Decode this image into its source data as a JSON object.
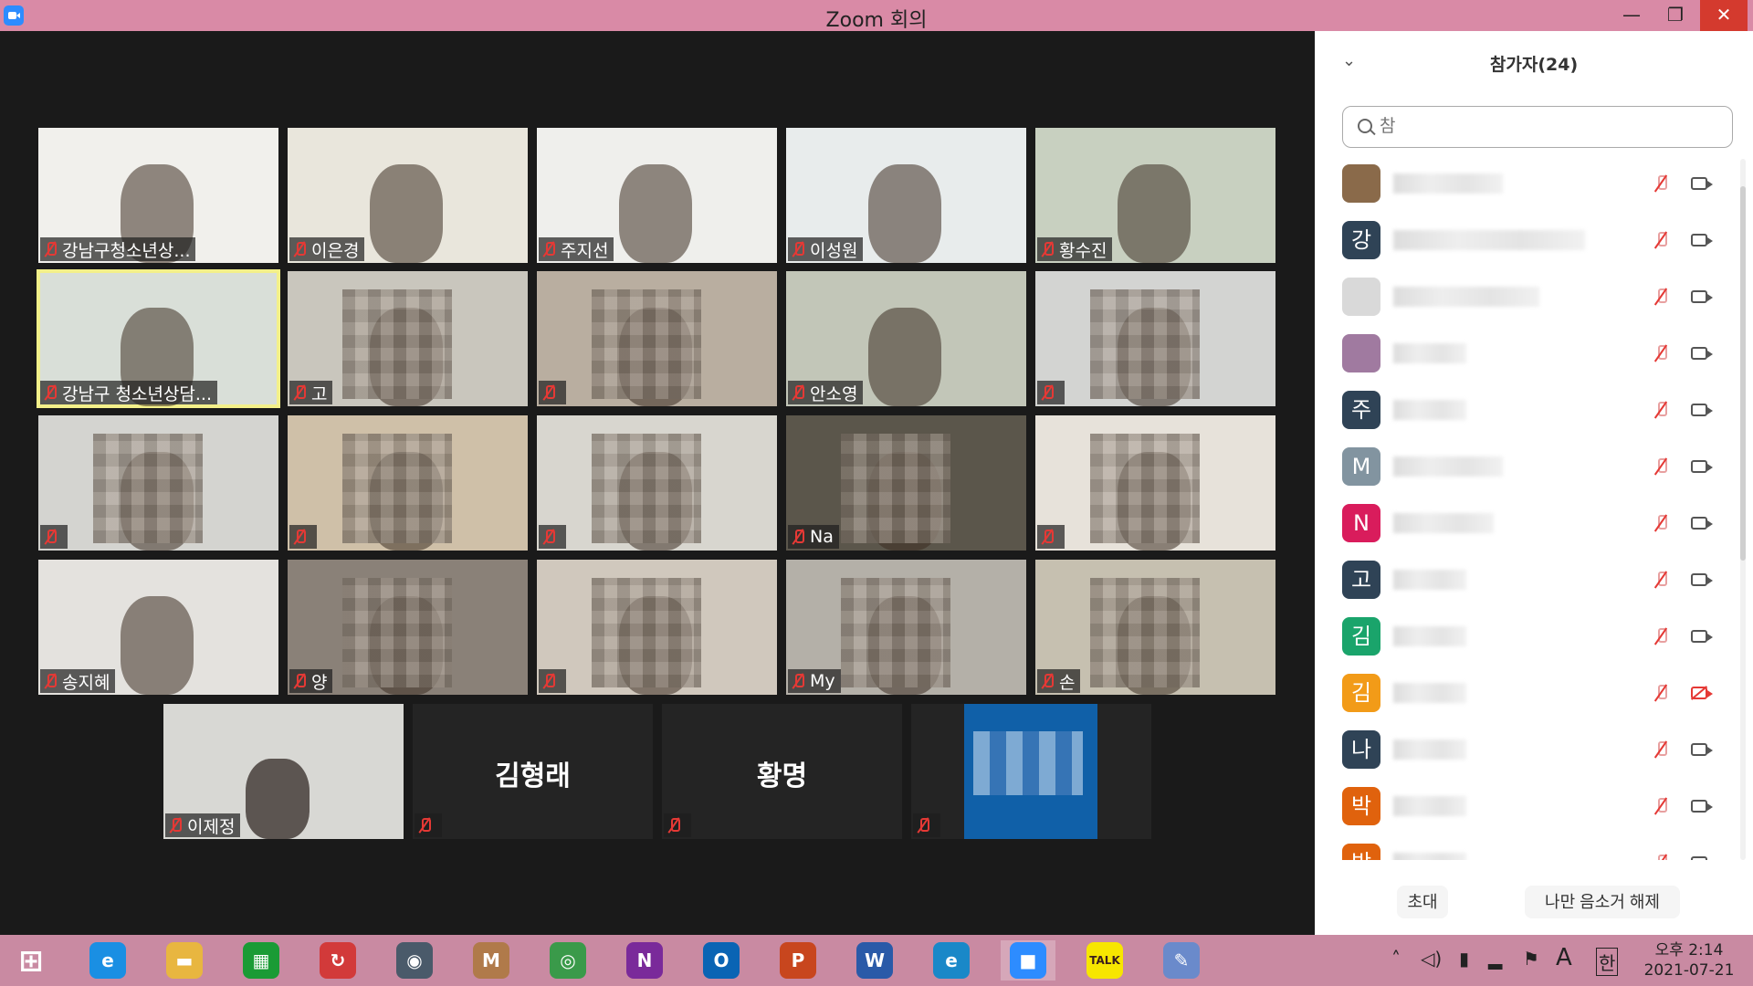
{
  "window": {
    "title": "Zoom 회의",
    "minimize": "—",
    "restore": "❐",
    "close": "✕"
  },
  "gallery": {
    "tiles": [
      {
        "name": "강남구청소년상...",
        "bg": "#f1f0ec",
        "active": false
      },
      {
        "name": "이은경",
        "bg": "#e9e6dc",
        "active": false
      },
      {
        "name": "주지선",
        "bg": "#efefec",
        "active": false
      },
      {
        "name": "이성원",
        "bg": "#e8ecec",
        "active": false
      },
      {
        "name": "황수진",
        "bg": "#c8d0c0",
        "active": false
      },
      {
        "name": "강남구 청소년상담...",
        "bg": "#d9dfd8",
        "active": true
      },
      {
        "name": "고",
        "bg": "#c9c6bd",
        "active": false
      },
      {
        "name": "",
        "bg": "#b9aea0",
        "active": false
      },
      {
        "name": "안소영",
        "bg": "#c2c6b8",
        "active": false
      },
      {
        "name": "",
        "bg": "#d3d4d2",
        "active": false
      },
      {
        "name": "",
        "bg": "#d4d4d0",
        "active": false
      },
      {
        "name": "",
        "bg": "#cfc0a8",
        "active": false
      },
      {
        "name": "",
        "bg": "#d8d6cf",
        "active": false
      },
      {
        "name": "Na",
        "bg": "#5b564b",
        "active": false
      },
      {
        "name": "",
        "bg": "#e7e2da",
        "active": false
      },
      {
        "name": "송지혜",
        "bg": "#e4e2de",
        "active": false
      },
      {
        "name": "양",
        "bg": "#8a8178",
        "active": false
      },
      {
        "name": "",
        "bg": "#d0c8bd",
        "active": false
      },
      {
        "name": "My",
        "bg": "#b4b0a8",
        "active": false
      },
      {
        "name": "손",
        "bg": "#c6c0b0",
        "active": false
      }
    ],
    "bottom": [
      {
        "name": "이제정",
        "big": "",
        "type": "video"
      },
      {
        "name": "",
        "big": "김형래",
        "type": "name"
      },
      {
        "name": "",
        "big": "황명",
        "type": "name"
      },
      {
        "name": "",
        "big": "",
        "type": "avatar"
      }
    ]
  },
  "panel": {
    "title": "참가자(24)",
    "search_placeholder": "참",
    "participants": [
      {
        "initial": "",
        "color": "#8a6a4a",
        "cam_off": false
      },
      {
        "initial": "강",
        "color": "#2f4356",
        "cam_off": false
      },
      {
        "initial": "",
        "color": "#d9d9d9",
        "cam_off": false
      },
      {
        "initial": "",
        "color": "#a07aa0",
        "cam_off": false
      },
      {
        "initial": "주",
        "color": "#2f4356",
        "cam_off": false
      },
      {
        "initial": "M",
        "color": "#8294a0",
        "cam_off": false
      },
      {
        "initial": "N",
        "color": "#d91c5c",
        "cam_off": false
      },
      {
        "initial": "고",
        "color": "#2f4356",
        "cam_off": false
      },
      {
        "initial": "김",
        "color": "#1aa46b",
        "cam_off": false
      },
      {
        "initial": "김",
        "color": "#f29b18",
        "cam_off": true
      },
      {
        "initial": "나",
        "color": "#2f4356",
        "cam_off": false
      },
      {
        "initial": "박",
        "color": "#e0620d",
        "cam_off": false
      },
      {
        "initial": "박",
        "color": "#e0620d",
        "cam_off": false
      }
    ],
    "invite_label": "초대",
    "unmute_label": "나만 음소거 해제"
  },
  "taskbar": {
    "apps": [
      {
        "id": "start",
        "glyph": "⊞",
        "color": "transparent"
      },
      {
        "id": "ie",
        "glyph": "e",
        "color": "#1a8fe3"
      },
      {
        "id": "explorer",
        "glyph": "▬",
        "color": "#e8b640"
      },
      {
        "id": "store",
        "glyph": "▦",
        "color": "#1a9b35"
      },
      {
        "id": "sync",
        "glyph": "↻",
        "color": "#d23a3a"
      },
      {
        "id": "webcam",
        "glyph": "◉",
        "color": "#4a5a6a"
      },
      {
        "id": "malware",
        "glyph": "M",
        "color": "#b07a4a"
      },
      {
        "id": "chrome",
        "glyph": "◎",
        "color": "#3a9a4a"
      },
      {
        "id": "onenote",
        "glyph": "N",
        "color": "#7a2a9a"
      },
      {
        "id": "outlook",
        "glyph": "O",
        "color": "#0a64b4"
      },
      {
        "id": "powerpoint",
        "glyph": "P",
        "color": "#c8461e"
      },
      {
        "id": "word",
        "glyph": "W",
        "color": "#2a5aa8"
      },
      {
        "id": "edge",
        "glyph": "e",
        "color": "#1a88c8"
      },
      {
        "id": "zoom",
        "glyph": "■",
        "color": "#2d8cff"
      },
      {
        "id": "kakaotalk",
        "glyph": "TALK",
        "color": "#f7e600"
      },
      {
        "id": "paint",
        "glyph": "✎",
        "color": "#6a8acb"
      }
    ],
    "tray": {
      "chevron": "˄",
      "volume": "◁)",
      "battery": "▮",
      "signal": "▂",
      "flag": "⚑",
      "ime_a": "A",
      "ime_han": "한"
    },
    "clock_time": "오후 2:14",
    "clock_date": "2021-07-21"
  }
}
